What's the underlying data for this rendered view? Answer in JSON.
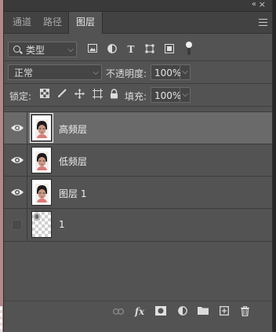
{
  "tabs": [
    {
      "label": "通道"
    },
    {
      "label": "路径"
    },
    {
      "label": "图层",
      "active": true
    }
  ],
  "window_controls": {
    "collapse_glyph": "«",
    "close_glyph": "×"
  },
  "filter": {
    "kind_label": "类型",
    "icons": [
      "pixel-filter-icon",
      "adjustment-filter-icon",
      "text-filter-icon",
      "shape-filter-icon",
      "smart-object-filter-icon",
      "filter-toggle-icon"
    ]
  },
  "blend": {
    "mode": "正常",
    "opacity_label": "不透明度:",
    "opacity_value": "100%"
  },
  "lock": {
    "label": "锁定:",
    "icons": [
      "lock-transparent-icon",
      "lock-image-icon",
      "lock-position-icon",
      "lock-artboard-icon",
      "lock-all-icon"
    ],
    "fill_label": "填充:",
    "fill_value": "100%"
  },
  "layers": [
    {
      "name": "高频层",
      "visible": true,
      "selected": true,
      "thumb": "portrait"
    },
    {
      "name": "低频层",
      "visible": true,
      "selected": false,
      "thumb": "portrait"
    },
    {
      "name": "图层 1",
      "visible": true,
      "selected": false,
      "thumb": "portrait"
    },
    {
      "name": "1",
      "visible": false,
      "selected": false,
      "thumb": "transparent"
    }
  ],
  "footer_icons": [
    "link-layers-icon",
    "fx-icon",
    "mask-icon",
    "adjustment-layer-icon",
    "new-group-icon",
    "new-layer-icon",
    "delete-icon"
  ],
  "colors": {
    "panel_bg": "#535353",
    "selected_row": "#6a6a6a",
    "text": "#e0e0e0"
  }
}
